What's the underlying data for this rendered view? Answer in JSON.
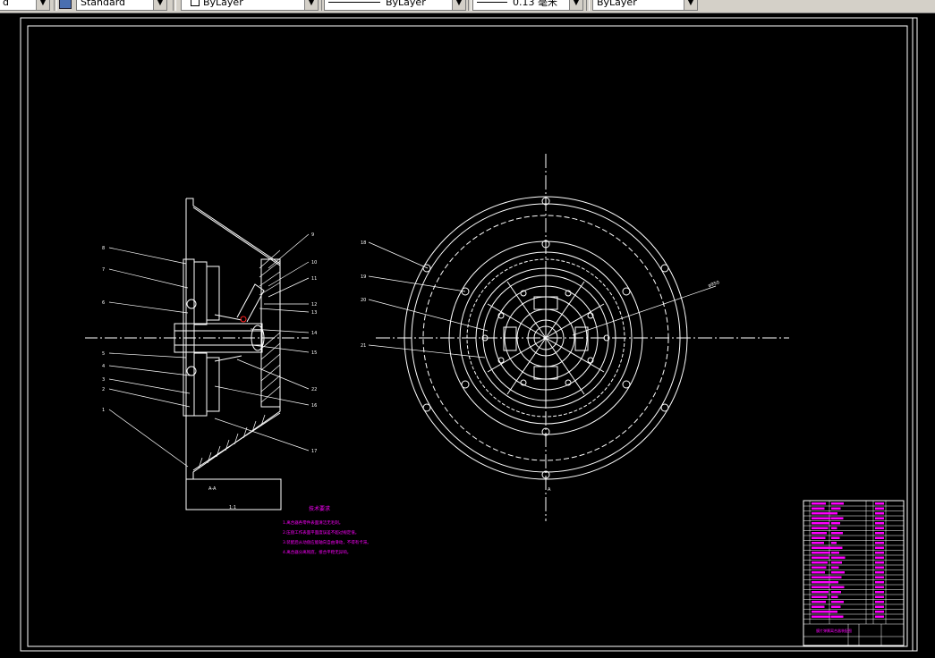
{
  "toolbar": {
    "combo_0": "d",
    "textstyle": "Standard",
    "layer": "ByLayer",
    "linetype": "ByLayer",
    "lineweight": "0.13 毫米",
    "plotstyle": "ByLayer"
  },
  "drawing": {
    "section_labels": [
      "8",
      "7",
      "6",
      "5",
      "4",
      "3",
      "2",
      "1",
      "9",
      "10",
      "11",
      "12",
      "13",
      "14",
      "15",
      "22",
      "16",
      "17"
    ],
    "section_caption": "A-A",
    "section_view_label": "1:1",
    "circle_labels": [
      "18",
      "19",
      "20",
      "21"
    ],
    "circle_dim_label": "φ950",
    "circle_view_label": "A",
    "tech_title": "技术要求",
    "tech_lines": [
      "1.离合器各零件表面清洁无毛刺。",
      "2.压盘工作表面平面度误差不超过规定值。",
      "3.装配后从动盘应能轴向自由滑动，不得有卡滞。",
      "4.离合器分离彻底，接合平稳无异响。"
    ],
    "title_block_name": "膜片弹簧离合器装配图"
  },
  "colors": {
    "line": "#ffffff",
    "accent": "#ff00ff",
    "red": "#ff2020",
    "background": "#000000"
  }
}
